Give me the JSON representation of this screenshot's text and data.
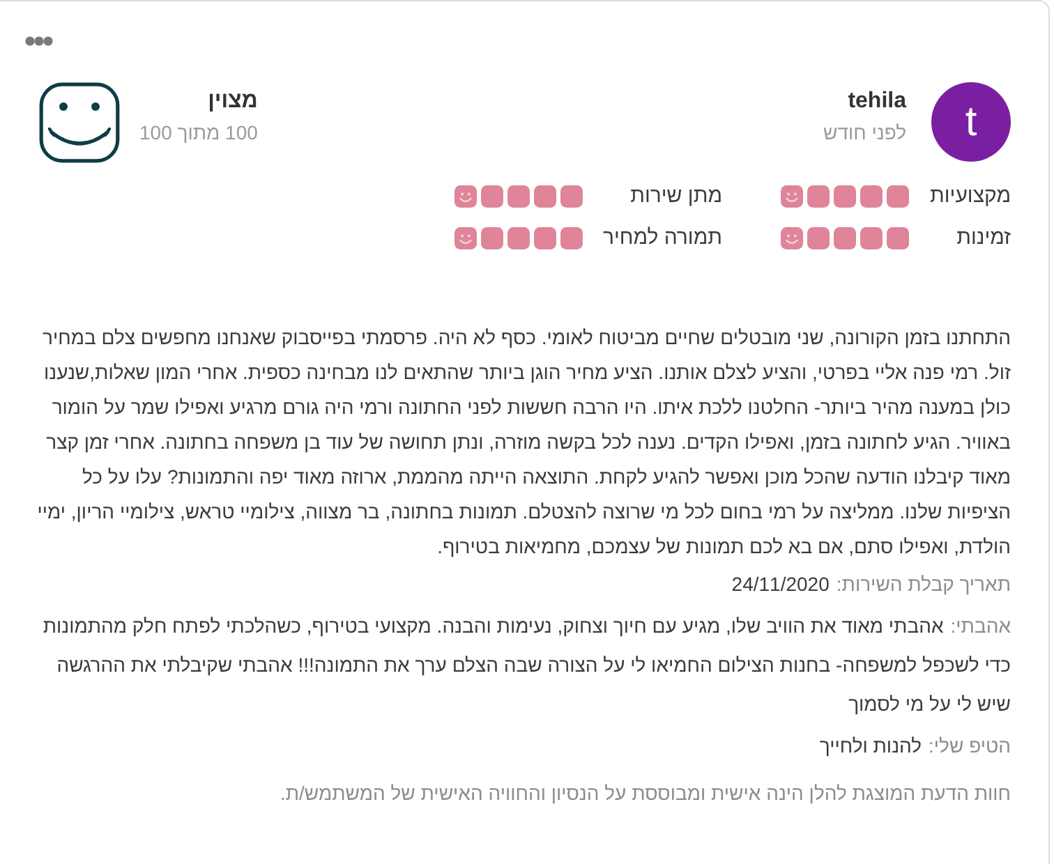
{
  "reviewer": {
    "avatar_letter": "t",
    "name": "tehila",
    "time": "לפני חודש"
  },
  "score": {
    "label": "מצוין",
    "text": "100 מתוך 100"
  },
  "ratings": [
    {
      "label": "מקצועיות",
      "stars": 5
    },
    {
      "label": "מתן שירות",
      "stars": 5
    },
    {
      "label": "זמינות",
      "stars": 5
    },
    {
      "label": "תמורה למחיר",
      "stars": 5
    }
  ],
  "review_text": "התחתנו בזמן הקורונה, שני מובטלים שחיים מביטוח לאומי. כסף לא היה. פרסמתי בפייסבוק שאנחנו מחפשים צלם במחיר זול. רמי פנה אליי בפרטי, והציע לצלם אותנו. הציע מחיר הוגן ביותר שהתאים לנו מבחינה כספית. אחרי המון שאלות,שנענו כולן במענה מהיר ביותר- החלטנו ללכת איתו. היו הרבה חששות לפני החתונה ורמי היה גורם מרגיע ואפילו שמר על הומור באוויר. הגיע לחתונה בזמן, ואפילו הקדים. נענה לכל בקשה מוזרה, ונתן תחושה של עוד בן משפחה בחתונה. אחרי זמן קצר מאוד קיבלנו הודעה שהכל מוכן ואפשר להגיע לקחת. התוצאה הייתה מהממת, ארוזה מאוד יפה והתמונות? עלו על כל הציפיות שלנו. ממליצה על רמי בחום לכל מי שרוצה להצטלם. תמונות בחתונה, בר מצווה, צילומיי טראש, צילומיי הריון, ימיי הולדת, ואפילו סתם, אם בא לכם תמונות של עצמכם, מחמיאות בטירוף.",
  "details": [
    {
      "label": "תאריך קבלת השירות:",
      "value": "24/11/2020"
    },
    {
      "label": "אהבתי:",
      "value": "אהבתי מאוד את הוויב שלו, מגיע עם חיוך וצחוק, נעימות והבנה. מקצועי בטירוף, כשהלכתי לפתח חלק מהתמונות כדי לשכפל למשפחה- בחנות הצילום החמיאו לי על הצורה שבה הצלם ערך את התמונה!!! אהבתי שקיבלתי את ההרגשה שיש לי על מי לסמוך"
    },
    {
      "label": "הטיפ שלי:",
      "value": "להנות ולחייך"
    }
  ],
  "disclaimer": "חוות הדעת המוצגת להלן הינה אישית ומבוססת על הנסיון והחוויה האישית של המשתמש/ת."
}
